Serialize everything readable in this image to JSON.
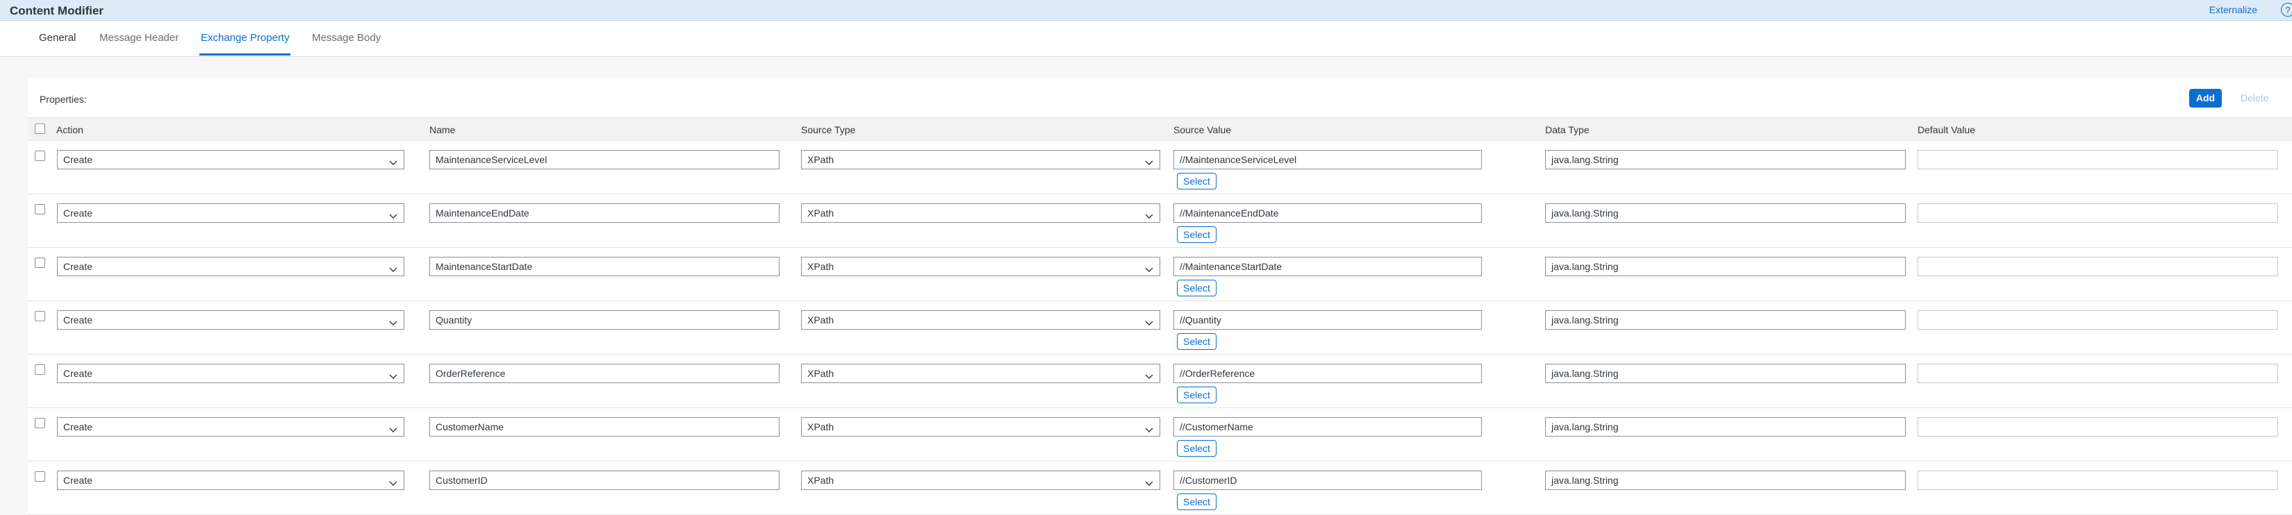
{
  "app": {
    "title": "Content Modifier",
    "externalize_label": "Externalize",
    "help_icon": "?"
  },
  "tabs": [
    {
      "label": "General"
    },
    {
      "label": "Message Header"
    },
    {
      "label": "Exchange Property",
      "selected": true
    },
    {
      "label": "Message Body"
    }
  ],
  "properties": {
    "label": "Properties:",
    "add_label": "Add",
    "delete_label": "Delete",
    "columns": [
      "Action",
      "Name",
      "Source Type",
      "Source Value",
      "Data Type",
      "Default Value"
    ],
    "select_button_label": "Select",
    "rows": [
      {
        "action": "Create",
        "name": "MaintenanceServiceLevel",
        "source_type": "XPath",
        "source_value": "//MaintenanceServiceLevel",
        "data_type": "java.lang.String",
        "default_value": ""
      },
      {
        "action": "Create",
        "name": "MaintenanceEndDate",
        "source_type": "XPath",
        "source_value": "//MaintenanceEndDate",
        "data_type": "java.lang.String",
        "default_value": ""
      },
      {
        "action": "Create",
        "name": "MaintenanceStartDate",
        "source_type": "XPath",
        "source_value": "//MaintenanceStartDate",
        "data_type": "java.lang.String",
        "default_value": ""
      },
      {
        "action": "Create",
        "name": "Quantity",
        "source_type": "XPath",
        "source_value": "//Quantity",
        "data_type": "java.lang.String",
        "default_value": ""
      },
      {
        "action": "Create",
        "name": "OrderReference",
        "source_type": "XPath",
        "source_value": "//OrderReference",
        "data_type": "java.lang.String",
        "default_value": ""
      },
      {
        "action": "Create",
        "name": "CustomerName",
        "source_type": "XPath",
        "source_value": "//CustomerName",
        "data_type": "java.lang.String",
        "default_value": ""
      },
      {
        "action": "Create",
        "name": "CustomerID",
        "source_type": "XPath",
        "source_value": "//CustomerID",
        "data_type": "java.lang.String",
        "default_value": ""
      }
    ]
  },
  "colors": {
    "accent": "#0a6ed1",
    "titlebar_bg": "#deeaf7",
    "header_bg": "#f2f2f2"
  }
}
